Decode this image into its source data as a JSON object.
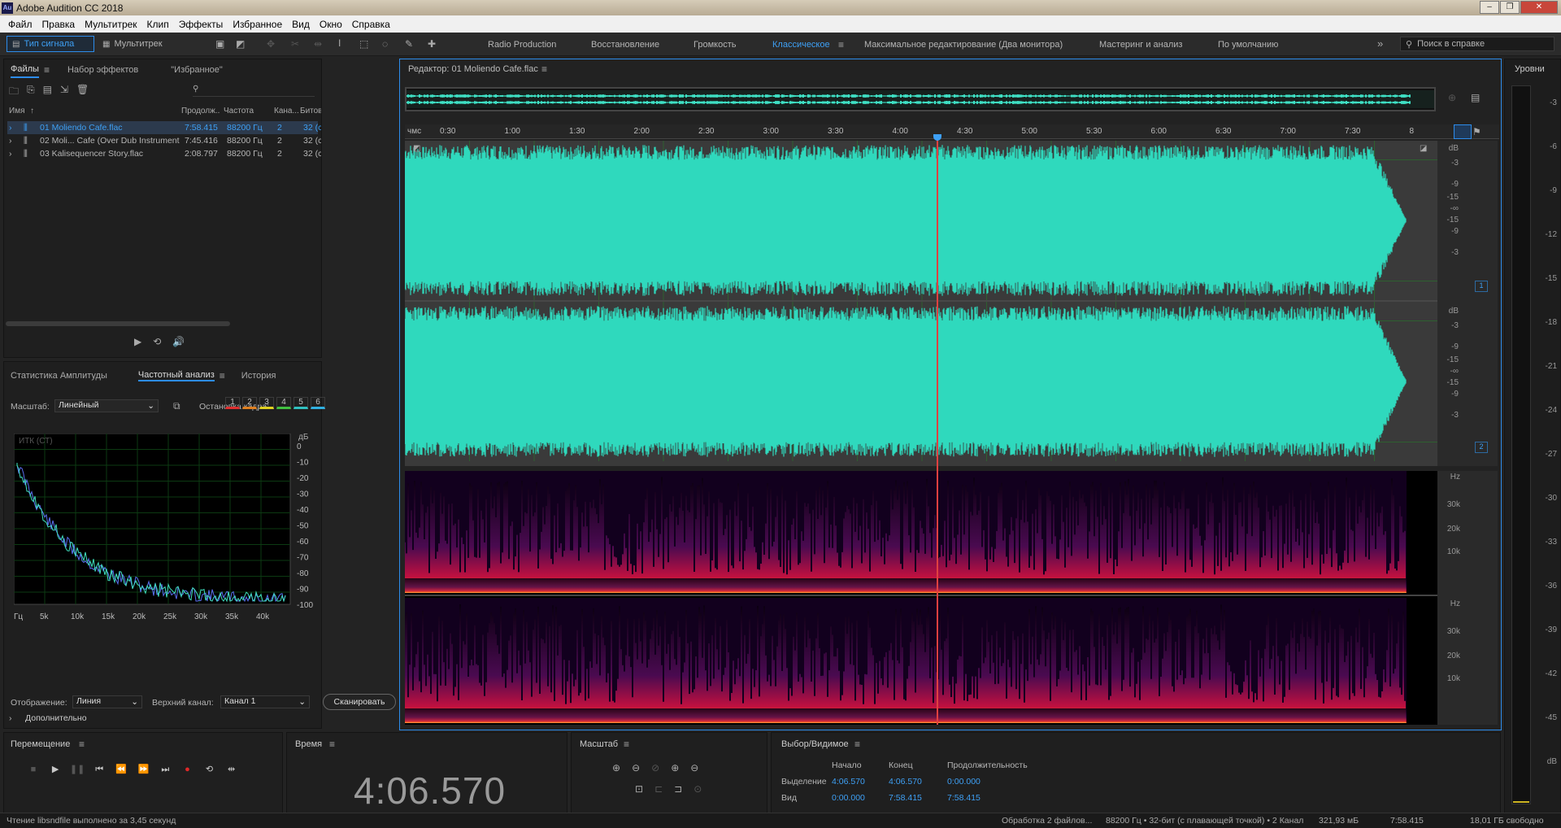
{
  "window": {
    "title": "Adobe Audition CC 2018",
    "app_icon": "Au"
  },
  "menu": [
    "Файл",
    "Правка",
    "Мультитрек",
    "Клип",
    "Эффекты",
    "Избранное",
    "Вид",
    "Окно",
    "Справка"
  ],
  "toolbar": {
    "waveform_label": "Тип сигнала",
    "multitrack_label": "Мультитрек",
    "workspaces": [
      "Radio Production",
      "Восстановление",
      "Громкость",
      "Классическое",
      "Максимальное редактирование (Два монитора)",
      "Мастеринг и анализ",
      "По умолчанию"
    ],
    "active_workspace": "Классическое",
    "help_search_placeholder": "Поиск в справке"
  },
  "files_panel": {
    "tabs": [
      "Файлы",
      "Набор эффектов",
      "\"Избранное\""
    ],
    "columns": [
      "Имя",
      "Продолж...",
      "Частота",
      "Кана...",
      "Битов"
    ],
    "rows": [
      {
        "name": "01 Moliendo Cafe.flac",
        "duration": "7:58.415",
        "rate": "88200 Гц",
        "channels": "2",
        "bits": "32 (с"
      },
      {
        "name": "02 Moli... Cafe (Over Dub Instrumental).flac",
        "duration": "7:45.416",
        "rate": "88200 Гц",
        "channels": "2",
        "bits": "32 (с"
      },
      {
        "name": "03 Kalisequencer Story.flac",
        "duration": "2:08.797",
        "rate": "88200 Гц",
        "channels": "2",
        "bits": "32 (с"
      }
    ]
  },
  "analysis_panel": {
    "tabs": [
      "Статистика Амплитуды",
      "Частотный анализ",
      "История"
    ],
    "scale_label": "Масштаб:",
    "scale_value": "Линейный",
    "freeze_label": "Остановка кадра:",
    "freeze_buttons": [
      "1",
      "2",
      "3",
      "4",
      "5",
      "6"
    ],
    "freeze_colors": [
      "#e03030",
      "#e08020",
      "#e0d020",
      "#40c040",
      "#30c0c0",
      "#30b0e0"
    ],
    "graph_label": "ИТК (СТ)",
    "db_unit": "дБ",
    "y_ticks": [
      "0",
      "-10",
      "-20",
      "-30",
      "-40",
      "-50",
      "-60",
      "-70",
      "-80",
      "-90",
      "-100"
    ],
    "x_ticks": [
      "Гц",
      "5k",
      "10k",
      "15k",
      "20k",
      "25k",
      "30k",
      "35k",
      "40k"
    ],
    "display_label": "Отображение:",
    "display_value": "Линия",
    "top_channel_label": "Верхний канал:",
    "top_channel_value": "Канал 1",
    "scan_button": "Сканировать",
    "advanced_label": "Дополнительно"
  },
  "editor": {
    "title": "Редактор: 01 Moliendo Cafe.flac",
    "timeline_unit": "чмс",
    "timeline_ticks": [
      "0:30",
      "1:00",
      "1:30",
      "2:00",
      "2:30",
      "3:00",
      "3:30",
      "4:00",
      "4:30",
      "5:00",
      "5:30",
      "6:00",
      "6:30",
      "7:00",
      "7:30",
      "8"
    ],
    "db_ticks_ch": [
      "dB",
      "-3",
      "-9",
      "-15",
      "-∞",
      "-15",
      "-9",
      "-3"
    ],
    "channel_badges": [
      "1",
      "2"
    ],
    "hz_ticks": [
      "Hz",
      "30k",
      "20k",
      "10k"
    ],
    "playhead_fraction": 0.515
  },
  "levels": {
    "title": "Уровни",
    "ticks": [
      "-3",
      "-6",
      "-9",
      "-12",
      "-15",
      "-18",
      "-21",
      "-24",
      "-27",
      "-30",
      "-33",
      "-36",
      "-39",
      "-42",
      "-45",
      "dB"
    ]
  },
  "transport": {
    "title": "Перемещение"
  },
  "time": {
    "title": "Время",
    "value": "4:06.570"
  },
  "zoom": {
    "title": "Масштаб"
  },
  "selection": {
    "title": "Выбор/Видимое",
    "headers": [
      "Начало",
      "Конец",
      "Продолжительность"
    ],
    "rows": [
      {
        "label": "Выделение",
        "start": "4:06.570",
        "end": "4:06.570",
        "duration": "0:00.000"
      },
      {
        "label": "Вид",
        "start": "0:00.000",
        "end": "7:58.415",
        "duration": "7:58.415"
      }
    ]
  },
  "status": {
    "left": "Чтение libsndfile выполнено за 3,45 секунд",
    "processing": "Обработка 2 файлов...",
    "format": "88200 Гц • 32-бит (с плавающей точкой) • 2 Канал",
    "size": "321,93 мБ",
    "duration": "7:58.415",
    "free": "18,01 ГБ свободно"
  }
}
